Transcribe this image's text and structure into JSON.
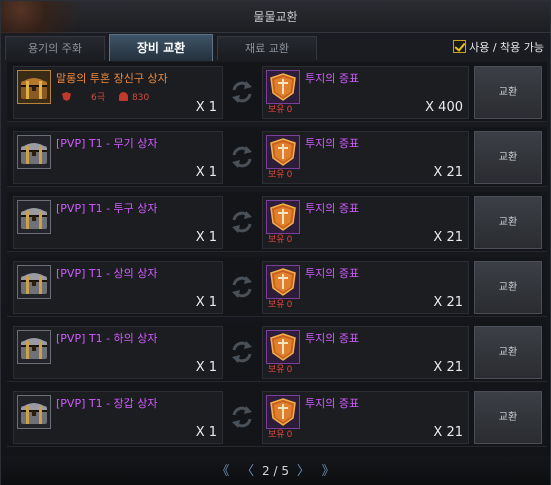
{
  "window": {
    "title": "물물교환"
  },
  "tabs": [
    {
      "label": "용기의 주화",
      "active": false
    },
    {
      "label": "장비 교환",
      "active": true
    },
    {
      "label": "재료 교환",
      "active": false
    }
  ],
  "usable_filter": {
    "label": "사용 / 착용 가능",
    "checked": true
  },
  "rows": [
    {
      "give": {
        "name": "말롱의 투혼 장신구 상자",
        "icon": "golden-chest-icon",
        "grade": "6극",
        "power": "830",
        "qty": "X 1"
      },
      "get": {
        "name": "투지의 증표",
        "icon": "shield-sword-token-icon",
        "owned_label": "보유",
        "owned": "0",
        "qty": "X 400"
      },
      "button": "교환"
    },
    {
      "give": {
        "name": "[PVP] T1 - 무기 상자",
        "icon": "silver-chest-icon",
        "qty": "X 1"
      },
      "get": {
        "name": "투지의 증표",
        "icon": "shield-sword-token-icon",
        "owned_label": "보유",
        "owned": "0",
        "qty": "X 21"
      },
      "button": "교환"
    },
    {
      "give": {
        "name": "[PVP] T1 - 투구 상자",
        "icon": "silver-chest-icon",
        "qty": "X 1"
      },
      "get": {
        "name": "투지의 증표",
        "icon": "shield-sword-token-icon",
        "owned_label": "보유",
        "owned": "0",
        "qty": "X 21"
      },
      "button": "교환"
    },
    {
      "give": {
        "name": "[PVP] T1 - 상의 상자",
        "icon": "silver-chest-icon",
        "qty": "X 1"
      },
      "get": {
        "name": "투지의 증표",
        "icon": "shield-sword-token-icon",
        "owned_label": "보유",
        "owned": "0",
        "qty": "X 21"
      },
      "button": "교환"
    },
    {
      "give": {
        "name": "[PVP] T1 - 하의 상자",
        "icon": "silver-chest-icon",
        "qty": "X 1"
      },
      "get": {
        "name": "투지의 증표",
        "icon": "shield-sword-token-icon",
        "owned_label": "보유",
        "owned": "0",
        "qty": "X 21"
      },
      "button": "교환"
    },
    {
      "give": {
        "name": "[PVP] T1 - 장갑 상자",
        "icon": "silver-chest-icon",
        "qty": "X 1"
      },
      "get": {
        "name": "투지의 증표",
        "icon": "shield-sword-token-icon",
        "owned_label": "보유",
        "owned": "0",
        "qty": "X 21"
      },
      "button": "교환"
    }
  ],
  "pager": {
    "current": "2",
    "separator": "/",
    "total": "5"
  },
  "colors": {
    "orange_name": "#f08a3a",
    "purple_name": "#d15bff",
    "owned_red": "#e0463b",
    "active_tab": "#3f5467",
    "check": "#f2c01d"
  }
}
